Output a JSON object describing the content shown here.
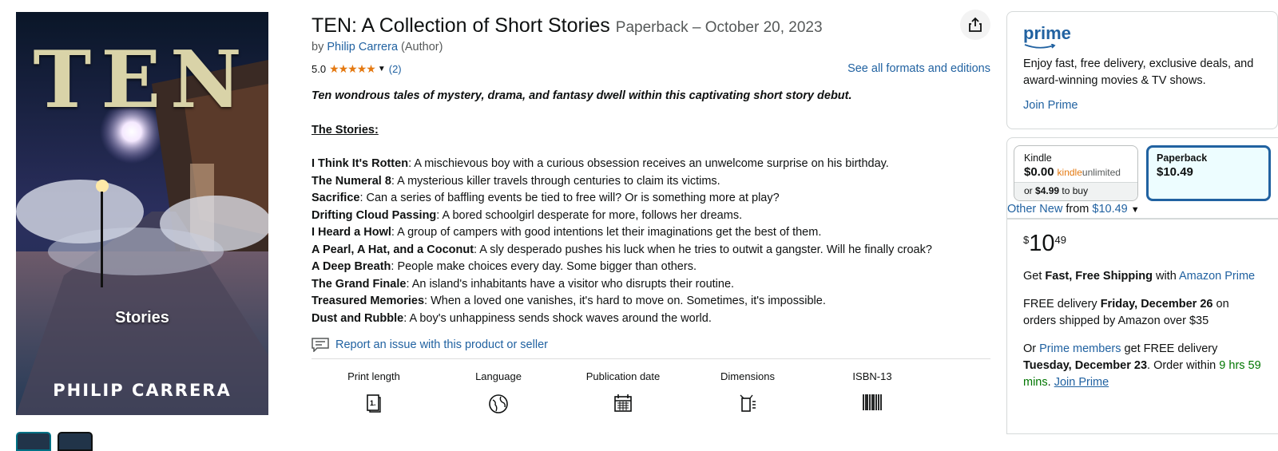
{
  "product": {
    "title": "TEN: A Collection of Short Stories",
    "edition": "Paperback – October 20, 2023",
    "by": "by",
    "author": "Philip Carrera",
    "author_role": "(Author)",
    "rating": "5.0",
    "stars": "★★★★★",
    "review_count": "(2)",
    "see_formats": "See all formats and editions"
  },
  "cover": {
    "title": "TEN",
    "subtitle": "Stories",
    "author": "PHILIP CARRERA"
  },
  "description": {
    "lead": "Ten wondrous tales of mystery, drama, and fantasy dwell within this captivating short story debut.",
    "heading": "The Stories:",
    "stories": [
      {
        "name": "I Think It's Rotten",
        "text": ": A mischievous boy with a curious obsession receives an unwelcome surprise on his birthday."
      },
      {
        "name": "The Numeral 8",
        "text": ": A mysterious killer travels through centuries to claim its victims."
      },
      {
        "name": "Sacrifice",
        "text": ": Can a series of baffling events be tied to free will? Or is something more at play?"
      },
      {
        "name": "Drifting Cloud Passing",
        "text": ": A bored schoolgirl desperate for more, follows her dreams."
      },
      {
        "name": "I Heard a Howl",
        "text": ": A group of campers with good intentions let their imaginations get the best of them."
      },
      {
        "name": "A Pearl, A Hat, and a Coconut",
        "text": ": A sly desperado pushes his luck when he tries to outwit a gangster. Will he finally croak?"
      },
      {
        "name": "A Deep Breath",
        "text": ": People make choices every day. Some bigger than others."
      },
      {
        "name": "The Grand Finale",
        "text": ": An island's inhabitants have a visitor who disrupts their routine."
      },
      {
        "name": "Treasured Memories",
        "text": ": When a loved one vanishes, it's hard to move on. Sometimes, it's impossible."
      },
      {
        "name": "Dust and Rubble",
        "text": ": A boy's unhappiness sends shock waves around the world."
      }
    ]
  },
  "report_link": "Report an issue with this product or seller",
  "details": [
    {
      "label": "Print length",
      "icon": "book-pages-icon"
    },
    {
      "label": "Language",
      "icon": "globe-icon"
    },
    {
      "label": "Publication date",
      "icon": "calendar-icon"
    },
    {
      "label": "Dimensions",
      "icon": "dimensions-icon"
    },
    {
      "label": "ISBN-13",
      "icon": "barcode-icon"
    }
  ],
  "prime": {
    "logo": "prime",
    "text": "Enjoy fast, free delivery, exclusive deals, and award-winning movies & TV shows.",
    "join": "Join Prime"
  },
  "formats": {
    "kindle": {
      "name": "Kindle",
      "price": "$0.00",
      "ku_a": "kindle",
      "ku_b": "unlimited",
      "or": "or",
      "buy_price": "$4.99",
      "buy": "to buy"
    },
    "paperback": {
      "name": "Paperback",
      "price": "$10.49"
    },
    "other_new_a": "Other New",
    "other_new_b": "from",
    "other_new_price": "$10.49"
  },
  "buy": {
    "currency": "$",
    "whole": "10",
    "fraction": "49",
    "ship_a": "Get",
    "ship_b": "Fast, Free Shipping",
    "ship_c": "with",
    "ship_link": "Amazon Prime",
    "free_a": "FREE delivery",
    "free_date": "Friday, December 26",
    "free_b": "on orders shipped by Amazon over $35",
    "or": "Or",
    "members_link": "Prime members",
    "members_a": "get FREE delivery",
    "members_date": "Tuesday, December 23",
    "order_within": ". Order within",
    "countdown": "9 hrs 59 mins",
    "join_link": "Join Prime"
  },
  "colors": {
    "link": "#2162a1",
    "star": "#e47911",
    "green": "#007600",
    "selected": "#2162a1"
  }
}
